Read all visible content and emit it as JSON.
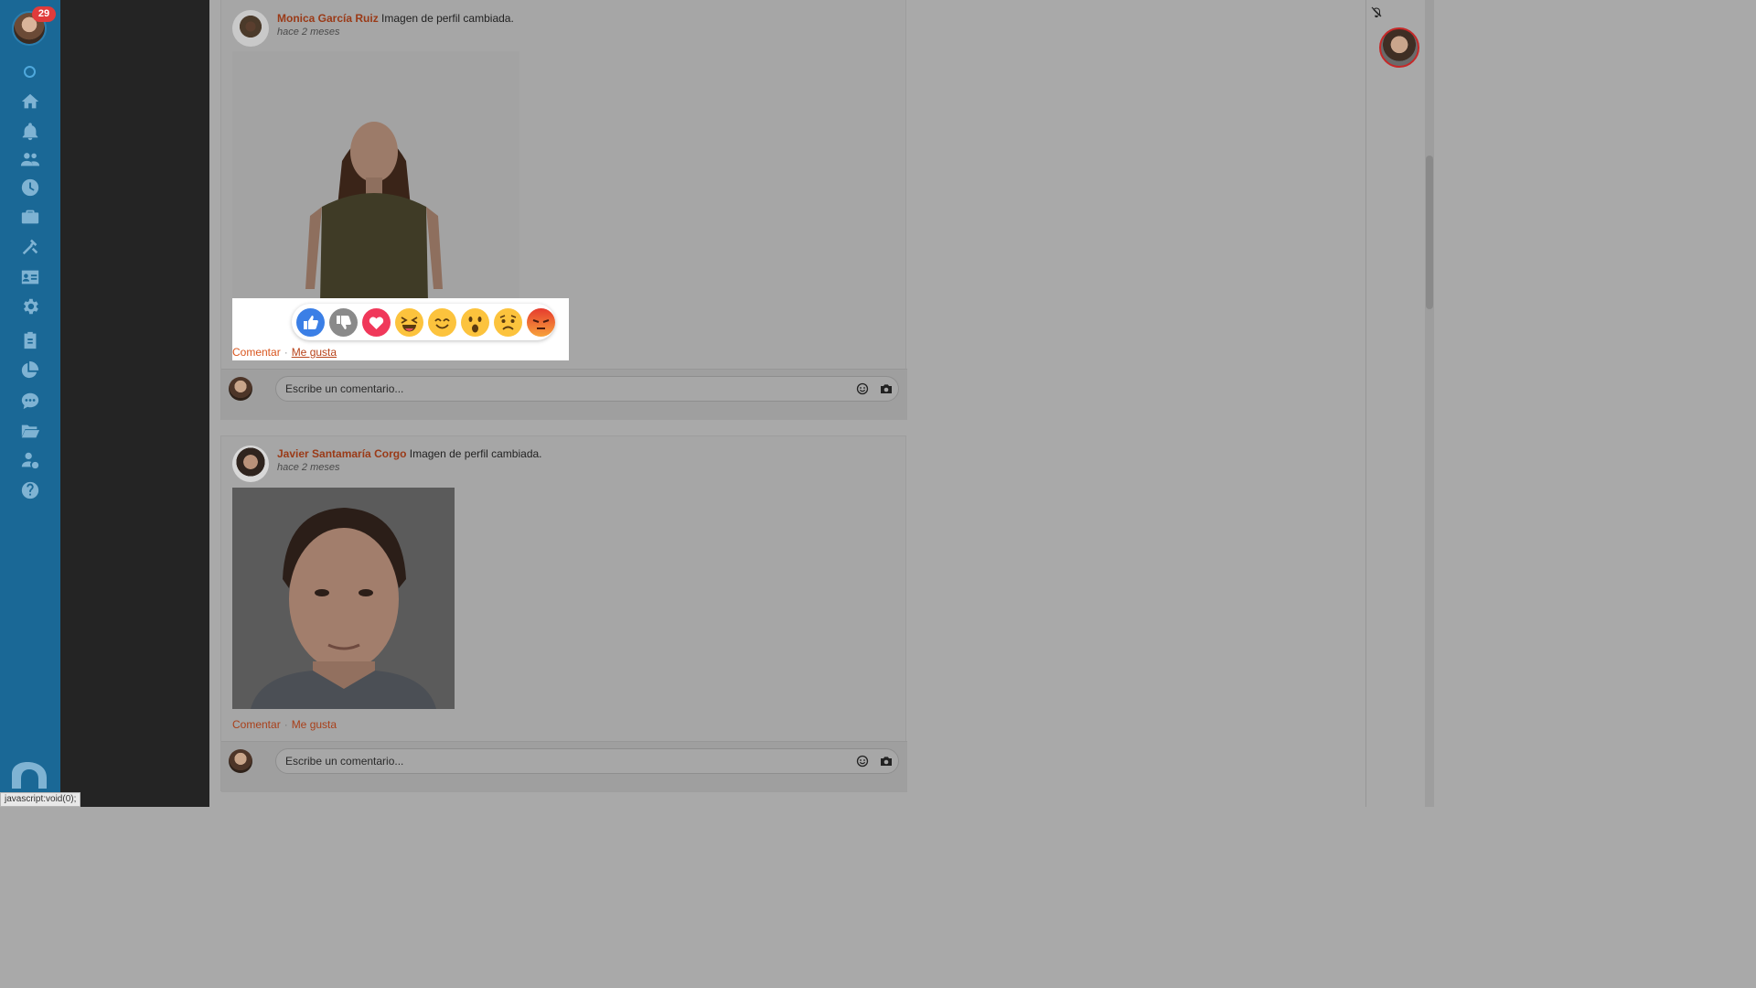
{
  "sidebar": {
    "notification_count": "29",
    "items": [
      {
        "name": "home"
      },
      {
        "name": "notifications"
      },
      {
        "name": "people"
      },
      {
        "name": "history"
      },
      {
        "name": "jobs"
      },
      {
        "name": "tools"
      },
      {
        "name": "contacts"
      },
      {
        "name": "settings"
      },
      {
        "name": "tasks"
      },
      {
        "name": "reports"
      },
      {
        "name": "chat"
      },
      {
        "name": "folders"
      },
      {
        "name": "user-billing"
      },
      {
        "name": "help"
      }
    ]
  },
  "posts": [
    {
      "author": "Monica García Ruiz",
      "action": "Imagen de perfil cambiada.",
      "time": "hace 2 meses",
      "comment_label": "Comentar",
      "like_label": "Me gusta",
      "comment_placeholder": "Escribe un comentario..."
    },
    {
      "author": "Javier Santamaría Corgo",
      "action": "Imagen de perfil cambiada.",
      "time": "hace 2 meses",
      "comment_label": "Comentar",
      "like_label": "Me gusta",
      "comment_placeholder": "Escribe un comentario..."
    }
  ],
  "reactions": [
    "like",
    "dislike",
    "love",
    "haha",
    "happy",
    "wow",
    "sad",
    "angry"
  ],
  "status_bar": "javascript:void(0);",
  "colors": {
    "rail": "#1a6896",
    "author": "#9a3a17",
    "link": "#d9561f",
    "badge": "#e03b3b"
  }
}
